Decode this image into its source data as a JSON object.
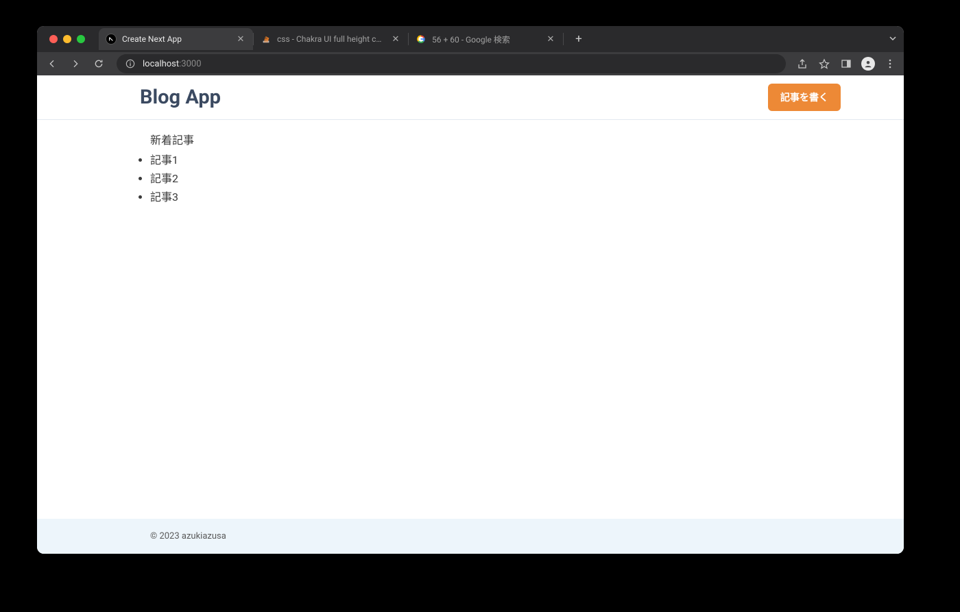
{
  "browser": {
    "tabs": [
      {
        "title": "Create Next App",
        "favicon": "next"
      },
      {
        "title": "css - Chakra UI full height com",
        "favicon": "stackoverflow"
      },
      {
        "title": "56 + 60 - Google 検索",
        "favicon": "google"
      }
    ],
    "url_host": "localhost",
    "url_port": ":3000"
  },
  "app": {
    "header": {
      "title": "Blog App",
      "write_button_label": "記事を書く"
    },
    "main": {
      "section_title": "新着記事",
      "articles": [
        "記事1",
        "記事2",
        "記事3"
      ]
    },
    "footer": {
      "copyright": "© 2023 azukiazusa"
    }
  }
}
